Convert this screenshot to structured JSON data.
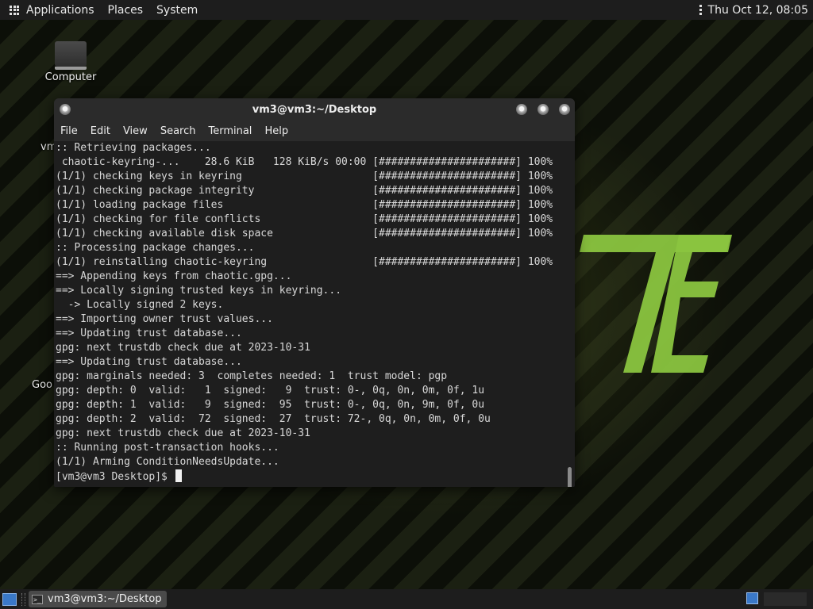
{
  "top_panel": {
    "menus": [
      "Applications",
      "Places",
      "System"
    ],
    "clock": "Thu Oct 12, 08:05"
  },
  "desktop": {
    "icons": [
      {
        "label": "Computer"
      }
    ],
    "partial_labels": [
      "vm",
      "Goo"
    ]
  },
  "terminal": {
    "title": "vm3@vm3:~/Desktop",
    "menus": [
      "File",
      "Edit",
      "View",
      "Search",
      "Terminal",
      "Help"
    ],
    "lines": [
      ":: Retrieving packages...",
      " chaotic-keyring-...    28.6 KiB   128 KiB/s 00:00 [######################] 100%",
      "(1/1) checking keys in keyring                     [######################] 100%",
      "(1/1) checking package integrity                   [######################] 100%",
      "(1/1) loading package files                        [######################] 100%",
      "(1/1) checking for file conflicts                  [######################] 100%",
      "(1/1) checking available disk space                [######################] 100%",
      ":: Processing package changes...",
      "(1/1) reinstalling chaotic-keyring                 [######################] 100%",
      "==> Appending keys from chaotic.gpg...",
      "==> Locally signing trusted keys in keyring...",
      "  -> Locally signed 2 keys.",
      "==> Importing owner trust values...",
      "==> Updating trust database...",
      "gpg: next trustdb check due at 2023-10-31",
      "==> Updating trust database...",
      "gpg: marginals needed: 3  completes needed: 1  trust model: pgp",
      "gpg: depth: 0  valid:   1  signed:   9  trust: 0-, 0q, 0n, 0m, 0f, 1u",
      "gpg: depth: 1  valid:   9  signed:  95  trust: 0-, 0q, 0n, 9m, 0f, 0u",
      "gpg: depth: 2  valid:  72  signed:  27  trust: 72-, 0q, 0n, 0m, 0f, 0u",
      "gpg: next trustdb check due at 2023-10-31",
      ":: Running post-transaction hooks...",
      "(1/1) Arming ConditionNeedsUpdate..."
    ],
    "prompt": "[vm3@vm3 Desktop]$ "
  },
  "taskbar": {
    "task_label": "vm3@vm3:~/Desktop"
  },
  "colors": {
    "panel": "#1d1d1d",
    "terminal_bg": "#1e1e1e",
    "logo_green": "#8ac43f",
    "accent_blue": "#3a78c8"
  }
}
